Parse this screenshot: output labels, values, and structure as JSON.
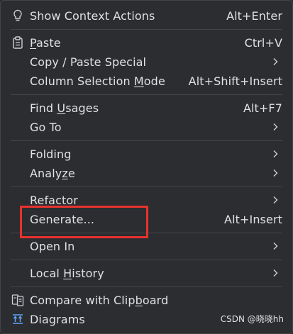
{
  "menu": {
    "items": [
      {
        "label": "Show Context Actions",
        "shortcut": "Alt+Enter",
        "icon": "bulb-icon"
      },
      {
        "label_pre": "",
        "label_u": "P",
        "label_post": "aste",
        "shortcut": "Ctrl+V",
        "icon": "clipboard-icon"
      },
      {
        "label": "Copy / Paste Special",
        "submenu": true
      },
      {
        "label_pre": "Column Selection ",
        "label_u": "M",
        "label_post": "ode",
        "shortcut": "Alt+Shift+Insert"
      },
      {
        "label_pre": "Find ",
        "label_u": "U",
        "label_post": "sages",
        "shortcut": "Alt+F7"
      },
      {
        "label": "Go To",
        "submenu": true
      },
      {
        "label": "Folding",
        "submenu": true
      },
      {
        "label_pre": "Analy",
        "label_u": "z",
        "label_post": "e",
        "submenu": true
      },
      {
        "label": "Refactor",
        "submenu": true
      },
      {
        "label": "Generate...",
        "shortcut": "Alt+Insert"
      },
      {
        "label": "Open In",
        "submenu": true
      },
      {
        "label_pre": "Local ",
        "label_u": "H",
        "label_post": "istory",
        "submenu": true
      },
      {
        "label_pre": "Compare with Clip",
        "label_u": "b",
        "label_post": "oard",
        "icon": "compare-icon"
      },
      {
        "label": "Diagrams",
        "icon": "diagram-icon"
      }
    ]
  },
  "watermark": "CSDN @晓晓hh",
  "colors": {
    "background": "#2b2d30",
    "text": "#dfe1e5",
    "separator": "#43454a",
    "highlight": "#e8322e"
  }
}
